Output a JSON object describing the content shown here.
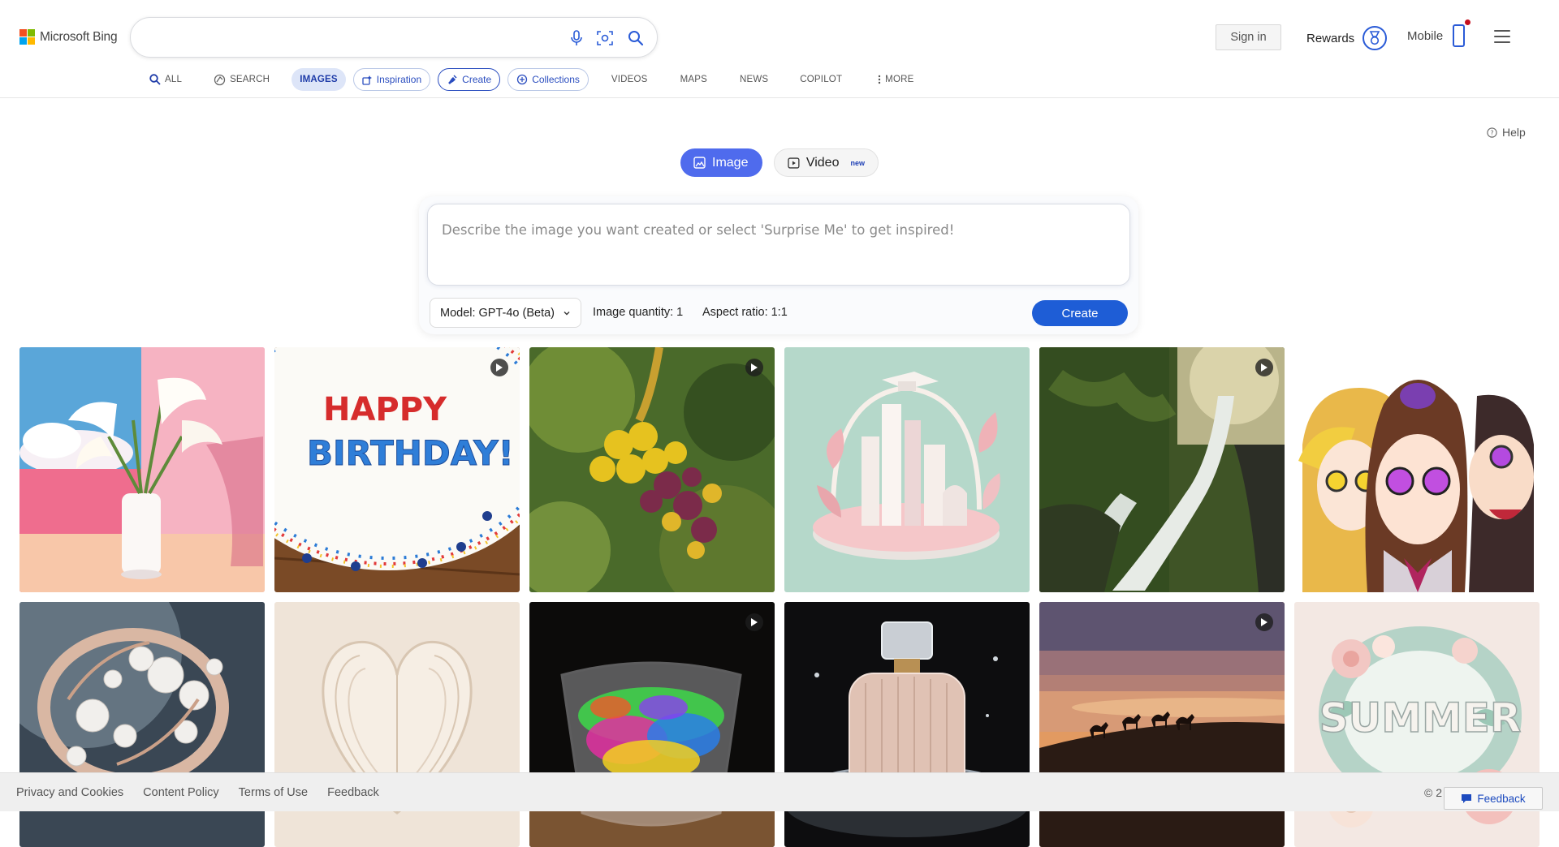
{
  "brand": {
    "name": "Microsoft Bing"
  },
  "search": {
    "value": ""
  },
  "header": {
    "signin_label": "Sign in",
    "rewards_label": "Rewards",
    "mobile_label": "Mobile"
  },
  "nav": [
    {
      "label": "ALL",
      "icon": "search-icon"
    },
    {
      "label": "SEARCH",
      "icon": "copilot-search-icon"
    },
    {
      "label": "IMAGES",
      "icon": "",
      "active": true
    },
    {
      "label": "Inspiration",
      "icon": "inspiration-icon"
    },
    {
      "label": "Create",
      "icon": "create-icon"
    },
    {
      "label": "Collections",
      "icon": "collections-icon"
    },
    {
      "label": "VIDEOS",
      "icon": ""
    },
    {
      "label": "MAPS",
      "icon": ""
    },
    {
      "label": "NEWS",
      "icon": ""
    },
    {
      "label": "COPILOT",
      "icon": ""
    },
    {
      "label": "MORE",
      "icon": "more-icon"
    }
  ],
  "help_label": "Help",
  "mode_toggle": {
    "image_label": "Image",
    "video_label": "Video",
    "video_badge": "new"
  },
  "creator": {
    "placeholder": "Describe the image you want created or select 'Surprise Me' to get inspired!",
    "model_label": "Model:",
    "model_value": "GPT-4o (Beta)",
    "quantity_text": "Image quantity: 1",
    "aspect_text": "Aspect ratio: 1:1",
    "create_label": "Create"
  },
  "gallery": [
    {
      "subject": "calla-lilies-vase",
      "video": false
    },
    {
      "subject": "birthday-cake",
      "video": true,
      "cake_text_1": "HAPPY",
      "cake_text_2": "BIRTHDAY!"
    },
    {
      "subject": "bee-flowers",
      "video": true
    },
    {
      "subject": "graduation-city-sculpture",
      "video": false
    },
    {
      "subject": "waterfall",
      "video": true
    },
    {
      "subject": "anime-characters",
      "video": false
    },
    {
      "subject": "pearl-ring",
      "video": false
    },
    {
      "subject": "paper-heart",
      "video": false
    },
    {
      "subject": "rainbow-glass-cup",
      "video": true
    },
    {
      "subject": "perfume-bottle",
      "video": false
    },
    {
      "subject": "desert-camels-sunset",
      "video": true
    },
    {
      "subject": "summer-paper-flowers",
      "video": false,
      "word": "SUMMER"
    }
  ],
  "footer": {
    "links": [
      "Privacy and Cookies",
      "Content Policy",
      "Terms of Use",
      "Feedback"
    ],
    "copyright": "© 2",
    "feedback_button": "Feedback"
  }
}
